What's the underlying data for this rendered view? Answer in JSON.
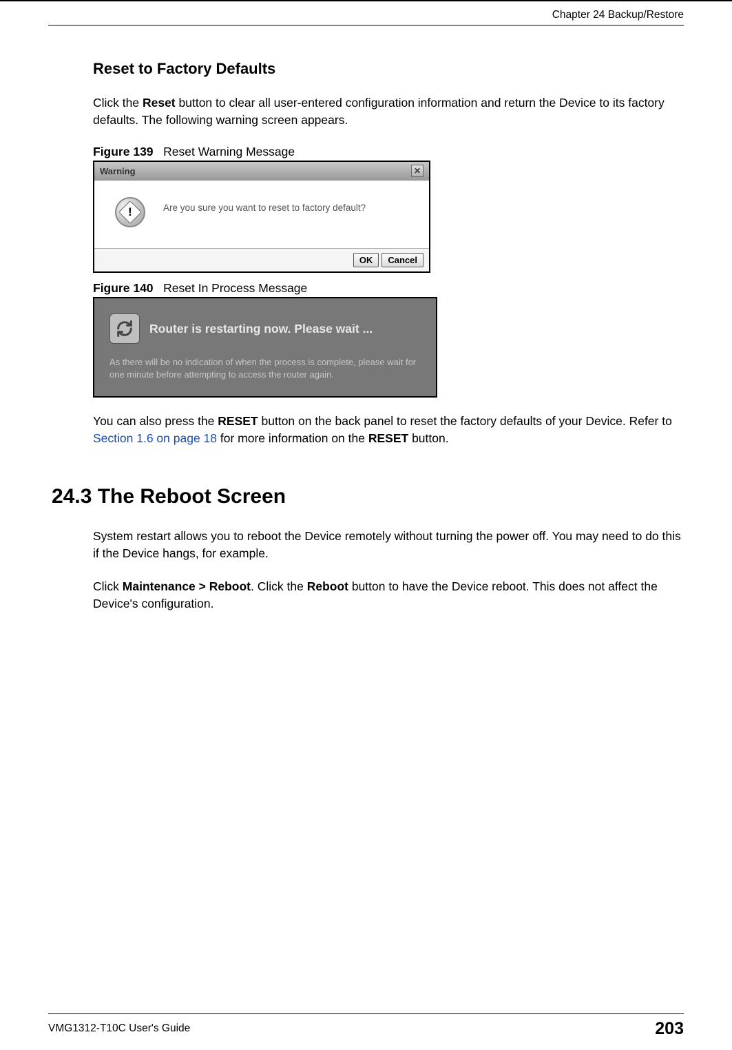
{
  "header": {
    "chapter": "Chapter 24 Backup/Restore"
  },
  "section1": {
    "title": "Reset to Factory Defaults",
    "para1_a": "Click the ",
    "para1_b": "Reset",
    "para1_c": " button to clear all user-entered configuration information and return the Device to its factory defaults. The following warning screen appears."
  },
  "figure139": {
    "label": "Figure 139",
    "caption": "Reset Warning Message",
    "dialog": {
      "title": "Warning",
      "close": "✕",
      "icon_mark": "!",
      "message": "Are you sure you want to reset to factory default?",
      "ok": "OK",
      "cancel": "Cancel"
    }
  },
  "figure140": {
    "label": "Figure 140",
    "caption": "Reset In Process Message",
    "dialog": {
      "title": "Router is restarting now. Please wait ...",
      "subtext": "As there will be no indication of when the process is complete, please wait for one minute before attempting to access the router again."
    }
  },
  "para2": {
    "a": "You can also press the ",
    "b": "RESET",
    "c": " button on the back panel to reset the factory defaults of your Device. Refer to ",
    "link": "Section 1.6 on page 18",
    "d": " for more information on the ",
    "e": "RESET",
    "f": " button."
  },
  "section2": {
    "heading": "24.3  The Reboot Screen",
    "para1": "System restart allows you to reboot the Device remotely without turning the power off. You may need to do this if the Device hangs, for example.",
    "para2_a": "Click ",
    "para2_b": "Maintenance > Reboot",
    "para2_c": ". Click the ",
    "para2_d": "Reboot",
    "para2_e": " button to have the Device reboot. This does not affect the Device's configuration."
  },
  "footer": {
    "guide": "VMG1312-T10C User's Guide",
    "page": "203"
  }
}
